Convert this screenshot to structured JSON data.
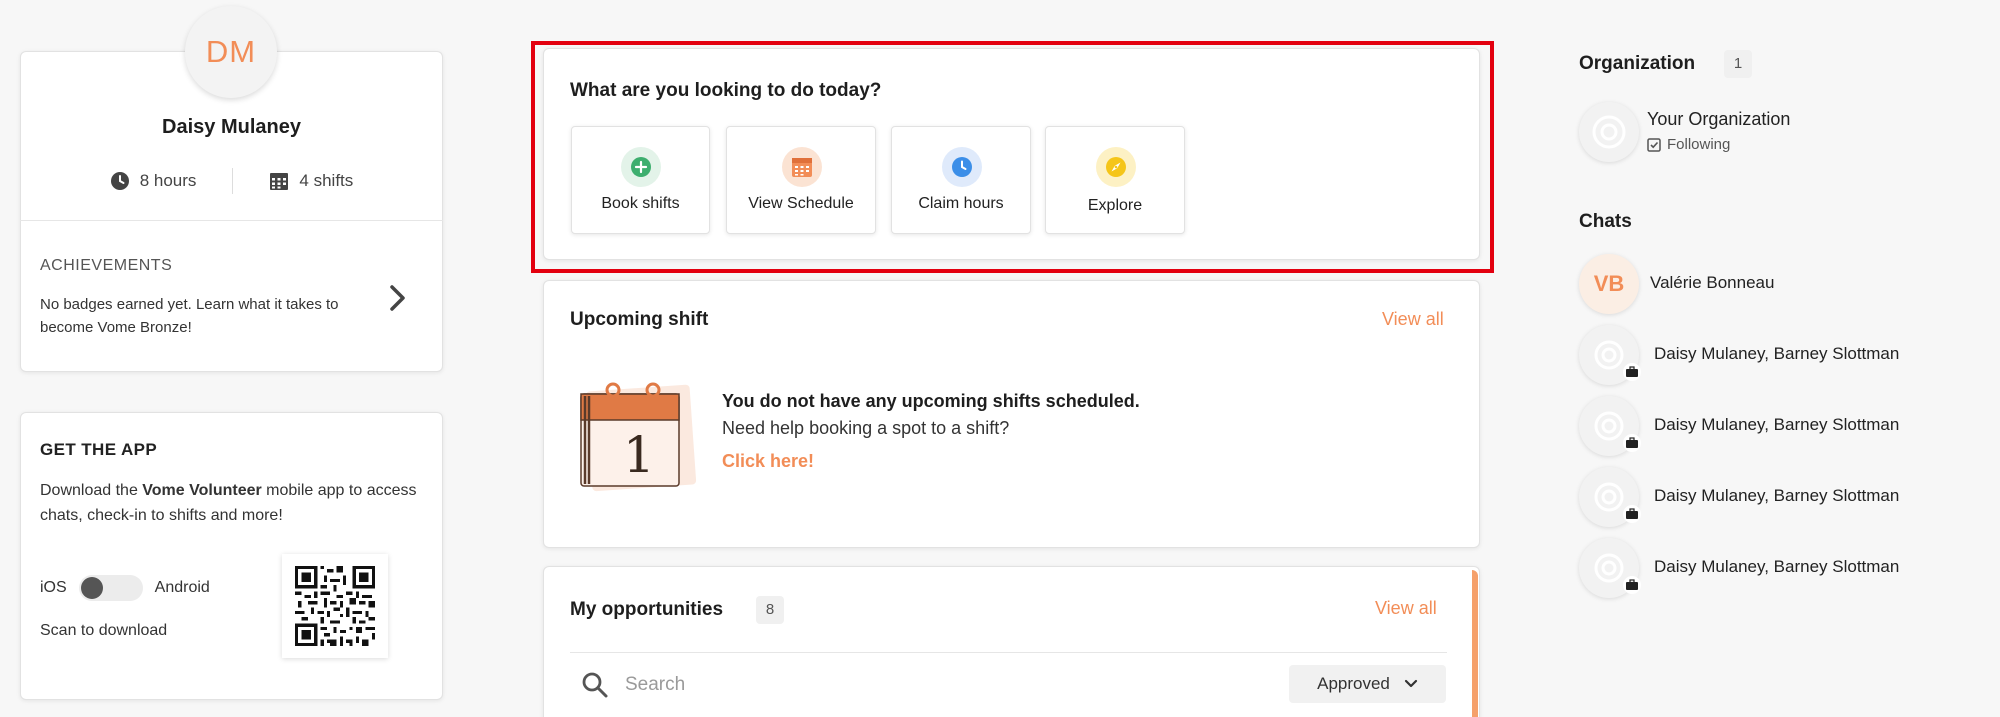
{
  "profile": {
    "initials": "DM",
    "name": "Daisy Mulaney",
    "hours": "8 hours",
    "shifts": "4 shifts",
    "achievements_title": "ACHIEVEMENTS",
    "achievements_text": "No badges earned yet. Learn what it takes to become Vome Bronze!"
  },
  "get_app": {
    "title": "GET THE APP",
    "desc_before": "Download the ",
    "desc_brand": "Vome Volunteer",
    "desc_after": " mobile app to access chats, check-in to shifts and more!",
    "ios_label": "iOS",
    "android_label": "Android",
    "scan_label": "Scan to download"
  },
  "quick_actions": {
    "title": "What are you looking to do today?",
    "items": [
      {
        "label": "Book shifts",
        "icon": "plus-circle-icon",
        "color": "#3dae6e"
      },
      {
        "label": "View Schedule",
        "icon": "calendar-icon",
        "color": "#f28d57"
      },
      {
        "label": "Claim hours",
        "icon": "clock-icon",
        "color": "#3b8ee8"
      },
      {
        "label": "Explore",
        "icon": "compass-icon",
        "color": "#f5c518"
      }
    ]
  },
  "upcoming": {
    "title": "Upcoming shift",
    "view_all": "View all",
    "calendar_number": "1",
    "empty_title": "You do not have any upcoming shifts scheduled.",
    "empty_sub": "Need help booking a spot to a shift?",
    "cta": "Click here!"
  },
  "opportunities": {
    "title": "My opportunities",
    "count": "8",
    "view_all": "View all",
    "search_placeholder": "Search",
    "status_filter": "Approved"
  },
  "organization": {
    "title": "Organization",
    "count": "1",
    "name": "Your Organization",
    "status": "Following"
  },
  "chats": {
    "title": "Chats",
    "items": [
      {
        "name": "Valérie Bonneau",
        "initials": "VB"
      },
      {
        "name": "Daisy Mulaney, Barney Slottman"
      },
      {
        "name": "Daisy Mulaney, Barney Slottman"
      },
      {
        "name": "Daisy Mulaney, Barney Slottman"
      },
      {
        "name": "Daisy Mulaney, Barney Slottman"
      }
    ]
  },
  "colors": {
    "accent": "#f28d57",
    "highlight_border": "#e3000f"
  }
}
